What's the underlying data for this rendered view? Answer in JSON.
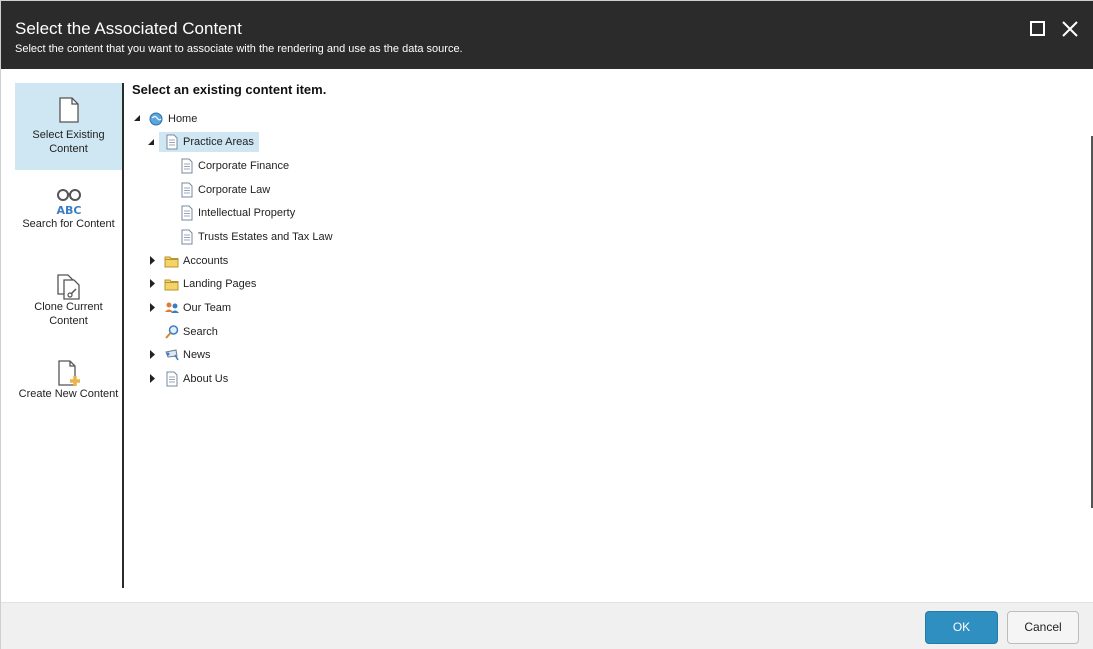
{
  "header": {
    "title": "Select the Associated Content",
    "subtitle": "Select the content that you want to associate with the rendering and use as the data source."
  },
  "nav": {
    "items": [
      {
        "label": "Select Existing Content",
        "icon": "document-icon",
        "active": true
      },
      {
        "label": "Search for Content",
        "icon": "binoculars-abc-icon",
        "active": false
      },
      {
        "label": "Clone Current Content",
        "icon": "clone-document-icon",
        "active": false
      },
      {
        "label": "Create New Content",
        "icon": "new-document-icon",
        "active": false
      }
    ]
  },
  "main": {
    "heading": "Select an existing content item."
  },
  "tree": [
    {
      "label": "Home",
      "icon": "home-globe-icon",
      "expanded": true
    },
    {
      "label": "Practice Areas",
      "icon": "page-icon",
      "expanded": true,
      "selected": true
    },
    {
      "label": "Corporate Finance",
      "icon": "page-icon"
    },
    {
      "label": "Corporate Law",
      "icon": "page-icon"
    },
    {
      "label": "Intellectual Property",
      "icon": "page-icon"
    },
    {
      "label": "Trusts Estates and Tax Law",
      "icon": "page-icon"
    },
    {
      "label": "Accounts",
      "icon": "folder-icon",
      "expanded": false
    },
    {
      "label": "Landing Pages",
      "icon": "folder-icon",
      "expanded": false
    },
    {
      "label": "Our Team",
      "icon": "people-icon",
      "expanded": false
    },
    {
      "label": "Search",
      "icon": "magnifier-icon"
    },
    {
      "label": "News",
      "icon": "news-icon",
      "expanded": false
    },
    {
      "label": "About Us",
      "icon": "page-icon",
      "expanded": false
    }
  ],
  "footer": {
    "ok_label": "OK",
    "cancel_label": "Cancel"
  },
  "colors": {
    "header_bg": "#2b2b2b",
    "accent": "#2f8fc0",
    "selection": "#cfe6f3"
  }
}
